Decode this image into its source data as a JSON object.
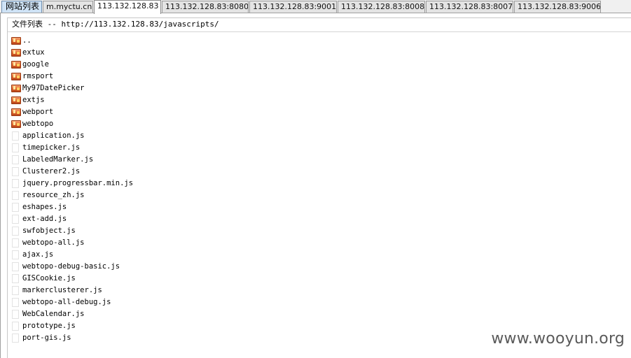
{
  "tabs": [
    {
      "label": "网站列表"
    },
    {
      "label": "m.myctu.cn"
    },
    {
      "label": "113.132.128.83"
    },
    {
      "label": "113.132.128.83:8080"
    },
    {
      "label": "113.132.128.83:9001"
    },
    {
      "label": "113.132.128.83:8008"
    },
    {
      "label": "113.132.128.83:8007"
    },
    {
      "label": "113.132.128.83:9006"
    }
  ],
  "active_tab": "113.132.128.83",
  "header": {
    "title_cn": "文件列表",
    "separator": " -- ",
    "path": "http://113.132.128.83/javascripts/"
  },
  "entries": [
    {
      "name": "..",
      "type": "folder",
      "icon": "folder-icon"
    },
    {
      "name": "extux",
      "type": "folder",
      "icon": "folder-icon"
    },
    {
      "name": "google",
      "type": "folder",
      "icon": "folder-icon"
    },
    {
      "name": "rmsport",
      "type": "folder",
      "icon": "folder-icon"
    },
    {
      "name": "My97DatePicker",
      "type": "folder",
      "icon": "folder-icon"
    },
    {
      "name": "extjs",
      "type": "folder",
      "icon": "folder-icon"
    },
    {
      "name": "webport",
      "type": "folder",
      "icon": "folder-icon"
    },
    {
      "name": "webtopo",
      "type": "folder",
      "icon": "folder-icon"
    },
    {
      "name": "application.js",
      "type": "file",
      "icon": "file-icon"
    },
    {
      "name": "timepicker.js",
      "type": "file",
      "icon": "file-icon"
    },
    {
      "name": "LabeledMarker.js",
      "type": "file",
      "icon": "file-icon"
    },
    {
      "name": "Clusterer2.js",
      "type": "file",
      "icon": "file-icon"
    },
    {
      "name": "jquery.progressbar.min.js",
      "type": "file",
      "icon": "file-icon"
    },
    {
      "name": "resource_zh.js",
      "type": "file",
      "icon": "file-icon"
    },
    {
      "name": "eshapes.js",
      "type": "file",
      "icon": "file-icon"
    },
    {
      "name": "ext-add.js",
      "type": "file",
      "icon": "file-icon"
    },
    {
      "name": "swfobject.js",
      "type": "file",
      "icon": "file-icon"
    },
    {
      "name": "webtopo-all.js",
      "type": "file",
      "icon": "file-icon"
    },
    {
      "name": "ajax.js",
      "type": "file",
      "icon": "file-icon"
    },
    {
      "name": "webtopo-debug-basic.js",
      "type": "file",
      "icon": "file-icon"
    },
    {
      "name": "GISCookie.js",
      "type": "file",
      "icon": "file-icon"
    },
    {
      "name": "markerclusterer.js",
      "type": "file",
      "icon": "file-icon"
    },
    {
      "name": "webtopo-all-debug.js",
      "type": "file",
      "icon": "file-icon"
    },
    {
      "name": "WebCalendar.js",
      "type": "file",
      "icon": "file-icon"
    },
    {
      "name": "prototype.js",
      "type": "file",
      "icon": "file-icon"
    },
    {
      "name": "port-gis.js",
      "type": "file",
      "icon": "file-icon"
    }
  ],
  "watermark": "www.wooyun.org",
  "colors": {
    "first_tab_bg": "#cfe3f6",
    "folder_icon": "#e0662c",
    "watermark": "#5a5a5a"
  }
}
